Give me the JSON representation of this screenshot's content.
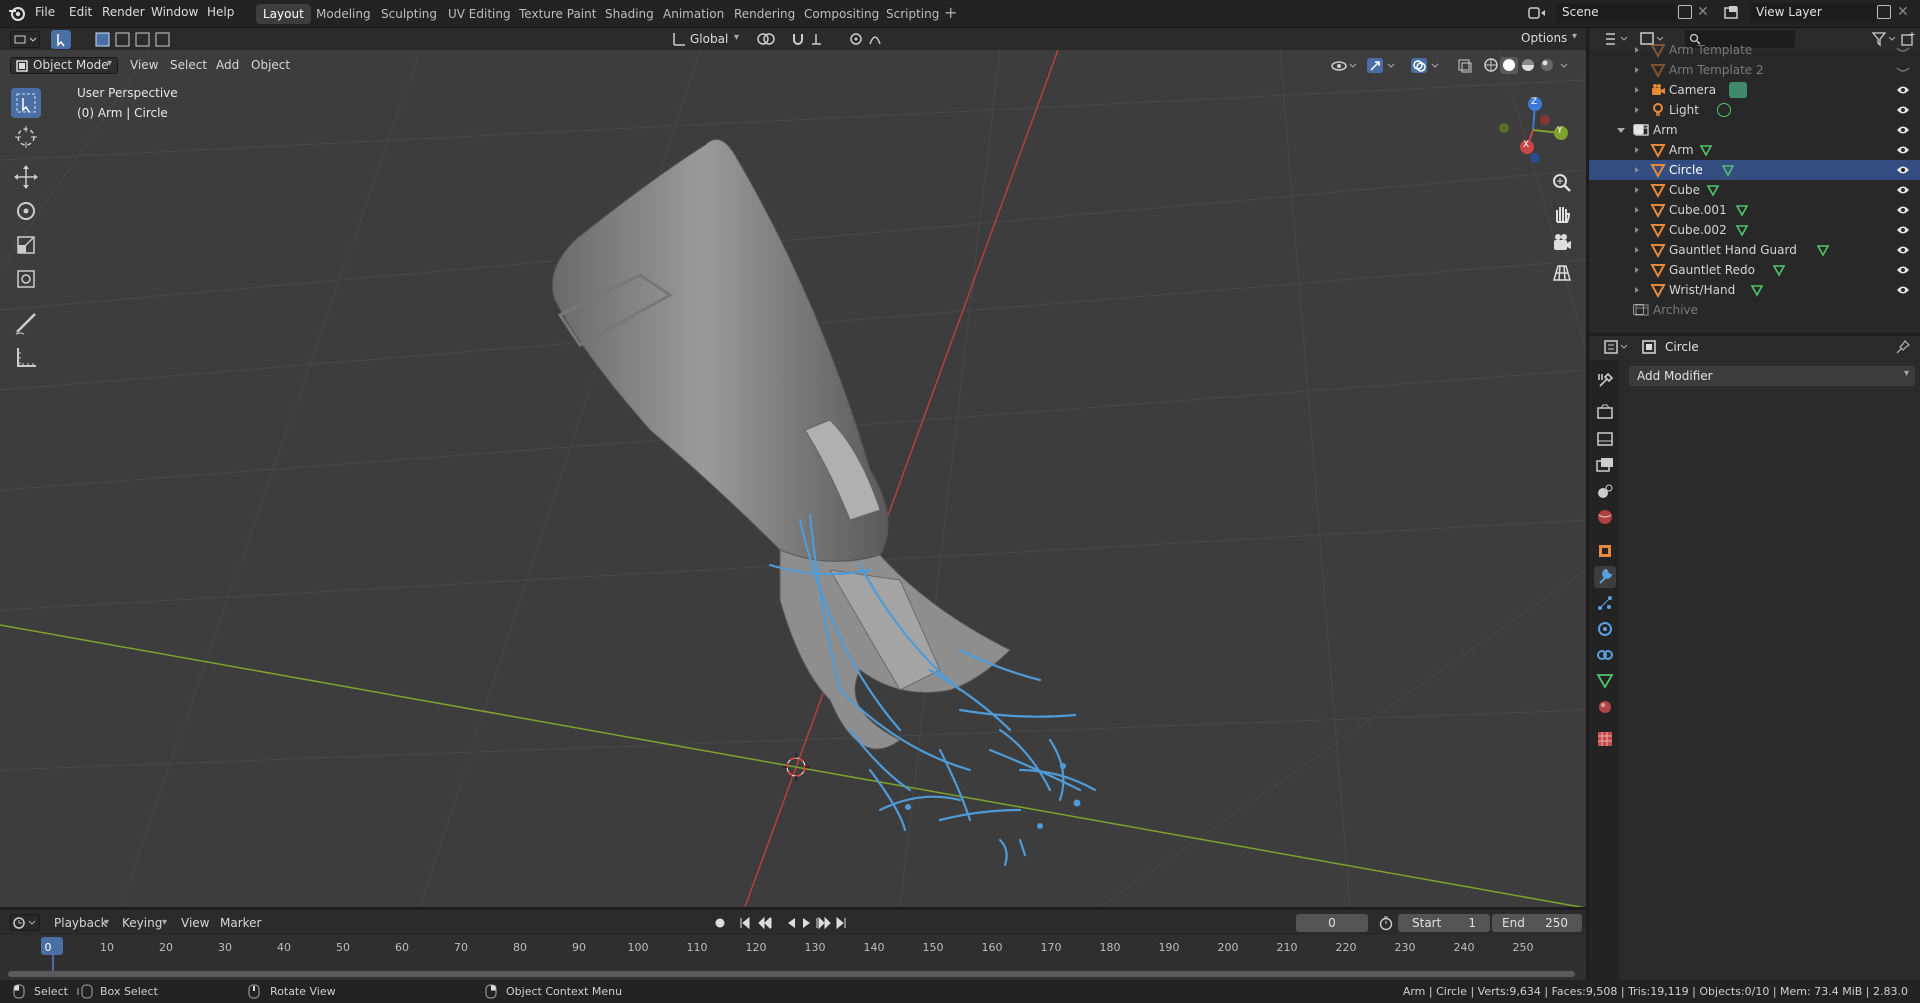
{
  "topbar": {
    "menus": [
      "File",
      "Edit",
      "Render",
      "Window",
      "Help"
    ],
    "workspaces": [
      "Layout",
      "Modeling",
      "Sculpting",
      "UV Editing",
      "Texture Paint",
      "Shading",
      "Animation",
      "Rendering",
      "Compositing",
      "Scripting"
    ],
    "active_workspace": "Layout",
    "scene_label": "Scene",
    "view_layer_label": "View Layer",
    "options_label": "Options",
    "transform_orientation": "Global"
  },
  "viewport_header": {
    "mode": "Object Mode",
    "menus": [
      "View",
      "Select",
      "Add",
      "Object"
    ]
  },
  "viewport": {
    "perspective": "User Perspective",
    "context": "(0) Arm | Circle",
    "axes": {
      "x": "X",
      "y": "Y",
      "z": "Z"
    }
  },
  "outliner": {
    "rows": [
      {
        "label": "Arm Template",
        "dim": true
      },
      {
        "label": "Arm Template 2",
        "dim": true
      },
      {
        "label": "Camera",
        "dim": false
      },
      {
        "label": "Light",
        "dim": false
      },
      {
        "label": "Arm",
        "dim": false,
        "collection": true
      },
      {
        "label": "Arm",
        "dim": false
      },
      {
        "label": "Circle",
        "dim": false,
        "selected": true
      },
      {
        "label": "Cube",
        "dim": false
      },
      {
        "label": "Cube.001",
        "dim": false
      },
      {
        "label": "Cube.002",
        "dim": false
      },
      {
        "label": "Gauntlet Hand Guard",
        "dim": false
      },
      {
        "label": "Gauntlet Redo",
        "dim": false
      },
      {
        "label": "Wrist/Hand",
        "dim": false
      },
      {
        "label": "Archive",
        "dim": true,
        "collection": true
      }
    ]
  },
  "properties": {
    "object_name": "Circle",
    "add_modifier": "Add Modifier"
  },
  "timeline": {
    "menus": [
      "Playback",
      "Keying",
      "View",
      "Marker"
    ],
    "current_frame": "0",
    "start_label": "Start",
    "start_value": "1",
    "end_label": "End",
    "end_value": "250",
    "ticks": [
      "0",
      "10",
      "20",
      "30",
      "40",
      "50",
      "60",
      "70",
      "80",
      "90",
      "100",
      "110",
      "120",
      "130",
      "140",
      "150",
      "160",
      "170",
      "180",
      "190",
      "200",
      "210",
      "220",
      "230",
      "240",
      "250"
    ]
  },
  "statusbar": {
    "select": "Select",
    "box_select": "Box Select",
    "rotate_view": "Rotate View",
    "context_menu": "Object Context Menu",
    "stats": "Arm | Circle | Verts:9,634 | Faces:9,508 | Tris:19,119 | Objects:0/10 | Mem: 73.4 MiB | 2.83.0"
  },
  "colors": {
    "accent": "#4b6fa5",
    "selection": "#334d80",
    "object_orange": "#e8883a",
    "mesh_green": "#4fc46b",
    "grease_pencil_blue": "#4e9bd8",
    "axis_x": "#c84848",
    "axis_y": "#8cb83a"
  }
}
